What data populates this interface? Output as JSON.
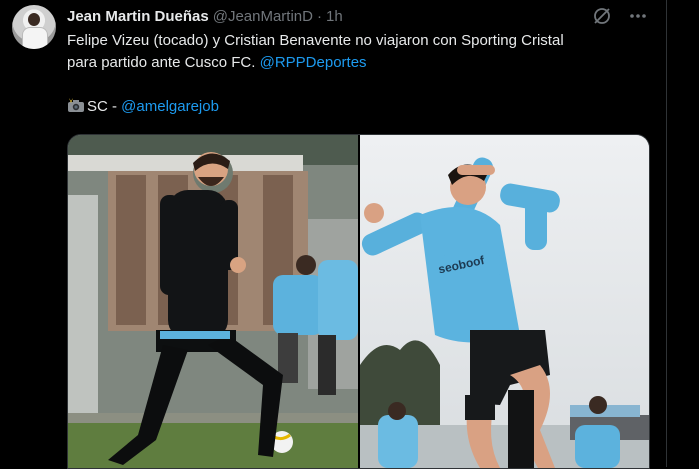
{
  "tweet": {
    "author_name": "Jean Martin Dueñas",
    "handle": "@JeanMartinD",
    "separator": "·",
    "time": "1h",
    "text_line1": "Felipe Vizeu (tocado) y Cristian Benavente no viajaron con Sporting Cristal",
    "text_line2": "para partido ante Cusco FC.",
    "mention_rpp": "@RPPDeportes",
    "credit_prefix": "SC - ",
    "credit_mention": "@amelgarejob"
  },
  "photos": {
    "right_shirt_text": "seoboof"
  },
  "colors": {
    "background": "#000000",
    "text": "#e7e9ea",
    "muted": "#71767b",
    "link": "#1d9bf0",
    "kit_sky_blue": "#5bb3df"
  },
  "icons": [
    "grok-icon",
    "more-icon",
    "camera-flash-icon"
  ]
}
